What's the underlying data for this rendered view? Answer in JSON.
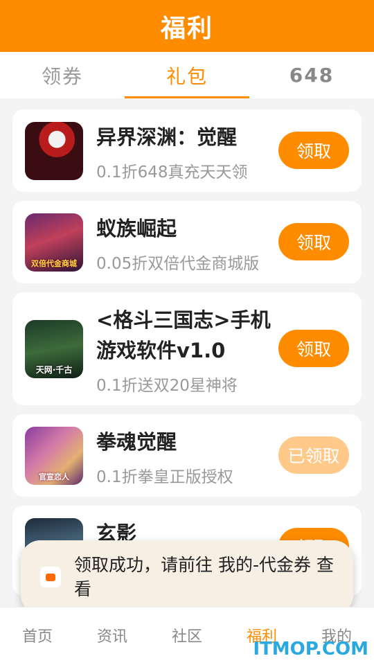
{
  "header": {
    "title": "福利"
  },
  "tabs": [
    {
      "label": "领券",
      "active": false
    },
    {
      "label": "礼包",
      "active": true
    },
    {
      "label": "648",
      "active": false
    }
  ],
  "cards": [
    {
      "name": "异界深渊：觉醒",
      "desc": "0.1折648真充天天领",
      "button": "领取",
      "claimed": false,
      "icon": "game-icon-warrior"
    },
    {
      "name": "蚁族崛起",
      "desc": "0.05折双倍代金商城版",
      "button": "领取",
      "claimed": false,
      "icon": "game-icon-queen",
      "icon_text": "双倍代金商城"
    },
    {
      "name": "<格斗三国志>手机游戏软件v1.0",
      "desc": "0.1折送双20星神将",
      "button": "领取",
      "claimed": false,
      "icon": "game-icon-three-kingdoms",
      "icon_text": "天网·千古"
    },
    {
      "name": "拳魂觉醒",
      "desc": "0.1折拳皇正版授权",
      "button": "已领取",
      "claimed": true,
      "icon": "game-icon-fighters",
      "icon_text": "官宣恋人"
    },
    {
      "name": "玄影",
      "desc": "",
      "button": "领取",
      "claimed": false,
      "icon": "game-icon-shadow"
    }
  ],
  "toast": {
    "text": "领取成功，请前往 我的-代金券 查看",
    "icon": "app-icon"
  },
  "bottom_nav": [
    {
      "label": "首页",
      "active": false
    },
    {
      "label": "资讯",
      "active": false
    },
    {
      "label": "社区",
      "active": false
    },
    {
      "label": "福利",
      "active": true
    },
    {
      "label": "我的",
      "active": false
    }
  ],
  "watermark": "ITMOP.COM",
  "colors": {
    "accent": "#ff8c00",
    "claimed": "#ffc98a",
    "toast_bg": "#f8efe4"
  }
}
